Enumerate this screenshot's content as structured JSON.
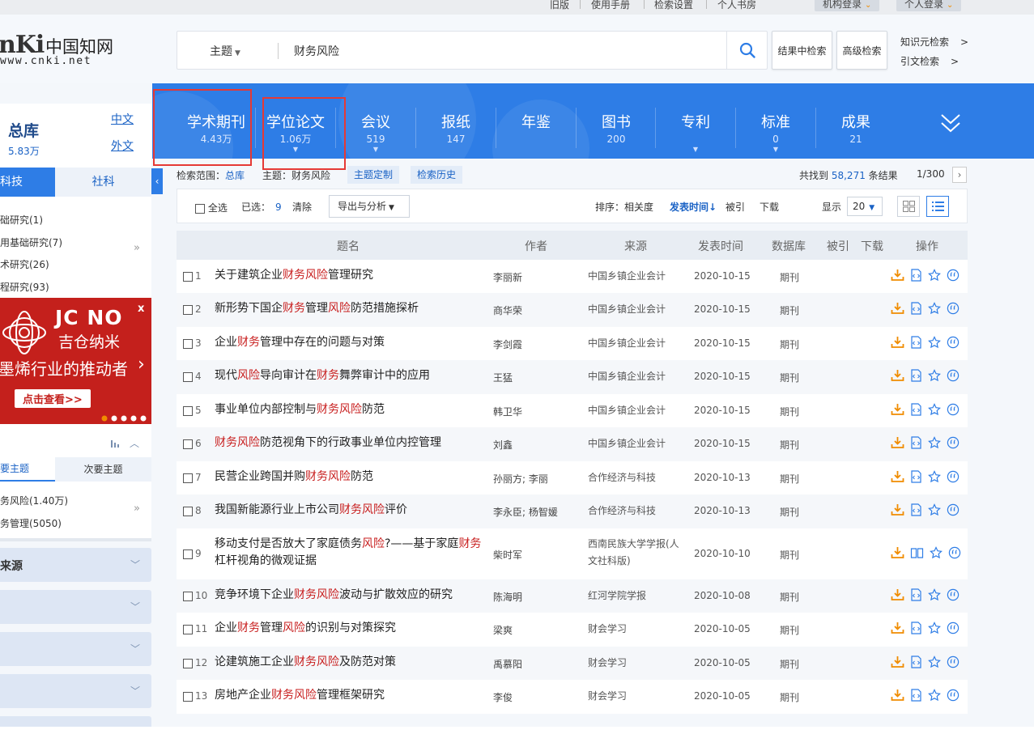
{
  "topbar": {
    "links": [
      "旧版",
      "使用手册",
      "检索设置",
      "个人书房"
    ],
    "institution_login": "机构登录",
    "personal_login": "个人登录"
  },
  "logo": {
    "brand": "nKi",
    "cn": "中国知网",
    "url": "www.cnki.net"
  },
  "search": {
    "field_type": "主题",
    "query": "财务风险",
    "result_search": "结果中检索",
    "advanced": "高级检索",
    "knowledge_search": "知识元检索",
    "citation_search": "引文检索",
    "arrow": ">"
  },
  "nav": {
    "tabs": [
      {
        "label": "学术期刊",
        "count": "4.43万",
        "caret": false
      },
      {
        "label": "学位论文",
        "count": "1.06万",
        "caret": true
      },
      {
        "label": "会议",
        "count": "519",
        "caret": true
      },
      {
        "label": "报纸",
        "count": "147",
        "caret": false
      },
      {
        "label": "年鉴",
        "count": "",
        "caret": false
      },
      {
        "label": "图书",
        "count": "200",
        "caret": false
      },
      {
        "label": "专利",
        "count": "",
        "caret": true
      },
      {
        "label": "标准",
        "count": "0",
        "caret": true
      },
      {
        "label": "成果",
        "count": "21",
        "caret": false
      }
    ]
  },
  "sidebar": {
    "library_title": "总库",
    "library_count": "5.83万",
    "lang_cn": "中文",
    "lang_foreign": "外文",
    "tab_sci": "科技",
    "tab_soc": "社科",
    "items": [
      "础研究(1)",
      "用基础研究(7)",
      "术研究(26)",
      "程研究(93)"
    ],
    "ad": {
      "brand": "JC NO",
      "brand_cn": "吉仓纳米",
      "slogan": "墨烯行业的推动者",
      "cta": "点击查看>>",
      "close": "x"
    },
    "topic_main": "要主题",
    "topic_sub": "次要主题",
    "topics": [
      "务风险(1.40万)",
      "务管理(5050)"
    ],
    "folds": [
      "来源",
      "",
      "",
      ""
    ]
  },
  "results": {
    "scope_label": "检索范围：",
    "scope_value": "总库",
    "topic_label": "主题：财务风险",
    "custom_btn": "主题定制",
    "history_btn": "检索历史",
    "found_prefix": "共找到",
    "total": "58,271",
    "found_suffix": "条结果",
    "page": "1/300",
    "select_all": "全选",
    "selected_label": "已选：",
    "selected_count": "9",
    "clear": "清除",
    "export": "导出与分析",
    "sort_label": "排序：",
    "sort_relevance": "相关度",
    "sort_date": "发表时间",
    "sort_cited": "被引",
    "sort_download": "下载",
    "display_label": "显示",
    "page_size": "20",
    "headers": [
      "题名",
      "作者",
      "来源",
      "发表时间",
      "数据库",
      "被引",
      "下载",
      "操作"
    ],
    "highlight_color": "#c81f1f",
    "rows": [
      {
        "no": "1",
        "title": [
          "关于建筑企业",
          "财务风险",
          "管理研究"
        ],
        "author": "李丽新",
        "source": "中国乡镇企业会计",
        "date": "2020-10-15",
        "db": "期刊"
      },
      {
        "no": "2",
        "title": [
          "新形势下国企",
          "财务",
          "管理",
          "风险",
          "防范措施探析"
        ],
        "author": "商华荣",
        "source": "中国乡镇企业会计",
        "date": "2020-10-15",
        "db": "期刊"
      },
      {
        "no": "3",
        "title": [
          "企业",
          "财务",
          "管理中存在的问题与对策"
        ],
        "author": "李剑霞",
        "source": "中国乡镇企业会计",
        "date": "2020-10-15",
        "db": "期刊"
      },
      {
        "no": "4",
        "title": [
          "现代",
          "风险",
          "导向审计在",
          "财务",
          "舞弊审计中的应用"
        ],
        "author": "王猛",
        "source": "中国乡镇企业会计",
        "date": "2020-10-15",
        "db": "期刊"
      },
      {
        "no": "5",
        "title": [
          "事业单位内部控制与",
          "财务风险",
          "防范"
        ],
        "author": "韩卫华",
        "source": "中国乡镇企业会计",
        "date": "2020-10-15",
        "db": "期刊"
      },
      {
        "no": "6",
        "title": [
          "",
          "财务风险",
          "防范视角下的行政事业单位内控管理"
        ],
        "author": "刘鑫",
        "source": "中国乡镇企业会计",
        "date": "2020-10-15",
        "db": "期刊"
      },
      {
        "no": "7",
        "title": [
          "民营企业跨国并购",
          "财务风险",
          "防范"
        ],
        "author": "孙丽方; 李丽",
        "source": "合作经济与科技",
        "date": "2020-10-13",
        "db": "期刊"
      },
      {
        "no": "8",
        "title": [
          "我国新能源行业上市公司",
          "财务风险",
          "评价"
        ],
        "author": "李永臣; 杨智媛",
        "source": "合作经济与科技",
        "date": "2020-10-13",
        "db": "期刊"
      },
      {
        "no": "9",
        "title": [
          "移动支付是否放大了家庭债务",
          "风险",
          "?——基于家庭",
          "财务",
          "杠杆视角的微观证据"
        ],
        "author": "柴时军",
        "source": "西南民族大学学报(人文社科版)",
        "date": "2020-10-10",
        "db": "期刊"
      },
      {
        "no": "10",
        "title": [
          "竞争环境下企业",
          "财务风险",
          "波动与扩散效应的研究"
        ],
        "author": "陈海明",
        "source": "红河学院学报",
        "date": "2020-10-08",
        "db": "期刊"
      },
      {
        "no": "11",
        "title": [
          "企业",
          "财务",
          "管理",
          "风险",
          "的识别与对策探究"
        ],
        "author": "梁爽",
        "source": "财会学习",
        "date": "2020-10-05",
        "db": "期刊"
      },
      {
        "no": "12",
        "title": [
          "论建筑施工企业",
          "财务风险",
          "及防范对策"
        ],
        "author": "禹慕阳",
        "source": "财会学习",
        "date": "2020-10-05",
        "db": "期刊"
      },
      {
        "no": "13",
        "title": [
          "房地产企业",
          "财务风险",
          "管理框架研究"
        ],
        "author": "李俊",
        "source": "财会学习",
        "date": "2020-10-05",
        "db": "期刊"
      }
    ]
  },
  "colors": {
    "primary": "#2e7de6",
    "highlight": "#c81f1f",
    "annotation": "#e53935",
    "download": "#f08c00"
  }
}
